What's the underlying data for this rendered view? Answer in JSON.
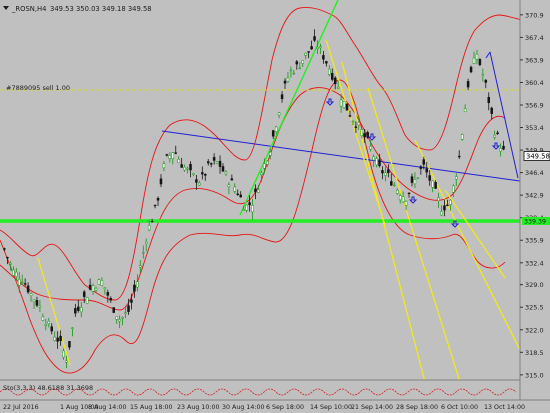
{
  "window": {
    "title": "_ROSN,H4",
    "ohlc": "349.53 350.03 349.18 349.58"
  },
  "order_label": "#7889095 sell 1.00",
  "stochastic_label": "Sto(3,3,3) 48.6188 31.3698",
  "current_price": "349.58",
  "support_price": "339.39",
  "chart_data": {
    "type": "candlestick",
    "title": "_ROSN,H4",
    "xlabel": "",
    "ylabel": "",
    "ylim": [
      314.2,
      373.2
    ],
    "y_ticks": [
      "370.9",
      "367.4",
      "363.9",
      "360.4",
      "356.9",
      "353.4",
      "349.9",
      "346.4",
      "342.9",
      "339.4",
      "335.9",
      "332.4",
      "329.0",
      "325.5",
      "322.0",
      "318.5",
      "315.0"
    ],
    "x_ticks": [
      "22 Jul 2016",
      "1 Aug 10:00",
      "8 Aug 14:00",
      "15 Aug 18:00",
      "23 Aug 10:00",
      "30 Aug 14:00",
      "6 Sep 18:00",
      "14 Sep 10:00",
      "21 Sep 14:00",
      "28 Sep 18:00",
      "6 Oct 10:00",
      "13 Oct 14:00"
    ],
    "approx_close_path": [
      [
        0,
        334.5
      ],
      [
        5,
        331.0
      ],
      [
        10,
        330.0
      ],
      [
        15,
        327.5
      ],
      [
        20,
        325.5
      ],
      [
        25,
        322.5
      ],
      [
        30,
        320.5
      ],
      [
        35,
        317.5
      ],
      [
        40,
        325.0
      ],
      [
        45,
        327.0
      ],
      [
        50,
        329.0
      ],
      [
        55,
        329.5
      ],
      [
        60,
        326.0
      ],
      [
        65,
        323.5
      ],
      [
        70,
        325.0
      ],
      [
        75,
        330.0
      ],
      [
        80,
        337.0
      ],
      [
        85,
        341.0
      ],
      [
        90,
        348.0
      ],
      [
        95,
        350.0
      ],
      [
        100,
        347.5
      ],
      [
        105,
        346.0
      ],
      [
        110,
        345.0
      ],
      [
        115,
        347.5
      ],
      [
        120,
        348.0
      ],
      [
        125,
        345.5
      ],
      [
        130,
        344.0
      ],
      [
        135,
        341.0
      ],
      [
        140,
        342.0
      ],
      [
        145,
        347.0
      ],
      [
        150,
        351.0
      ],
      [
        155,
        357.5
      ],
      [
        160,
        362.0
      ],
      [
        165,
        363.0
      ],
      [
        170,
        365.0
      ],
      [
        175,
        366.5
      ],
      [
        180,
        364.0
      ],
      [
        185,
        361.0
      ],
      [
        190,
        357.5
      ],
      [
        195,
        355.0
      ],
      [
        200,
        353.0
      ],
      [
        205,
        350.5
      ],
      [
        210,
        347.0
      ],
      [
        215,
        346.0
      ],
      [
        220,
        344.0
      ],
      [
        225,
        342.5
      ],
      [
        230,
        345.0
      ],
      [
        235,
        347.5
      ],
      [
        240,
        344.5
      ],
      [
        245,
        341.0
      ],
      [
        250,
        341.5
      ],
      [
        255,
        348.5
      ],
      [
        260,
        360.0
      ],
      [
        265,
        365.0
      ],
      [
        270,
        360.0
      ],
      [
        275,
        353.0
      ],
      [
        280,
        349.6
      ]
    ],
    "support_level": 339.39,
    "order_level": 359.9
  }
}
